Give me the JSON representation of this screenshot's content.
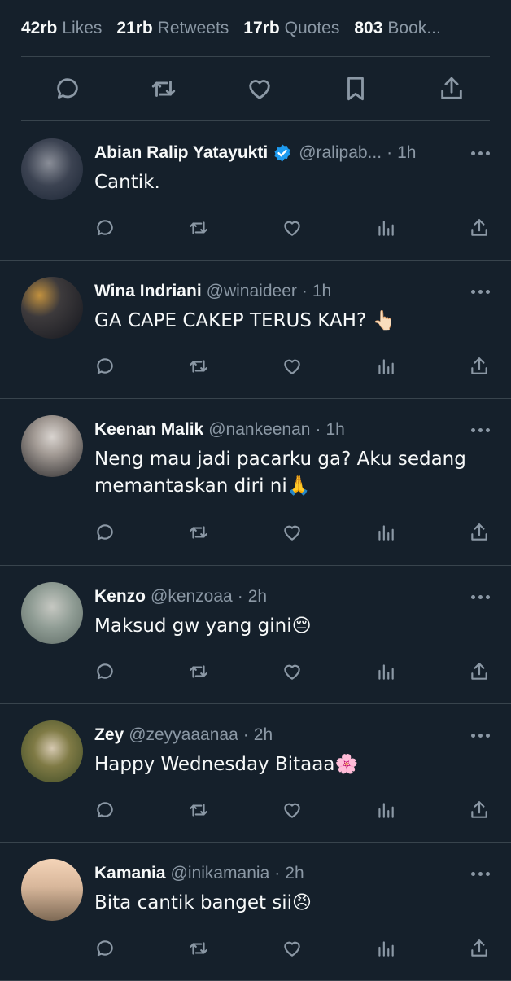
{
  "stats": [
    {
      "value": "42rb",
      "label": "Likes"
    },
    {
      "value": "21rb",
      "label": "Retweets"
    },
    {
      "value": "17rb",
      "label": "Quotes"
    },
    {
      "value": "803",
      "label": "Book..."
    }
  ],
  "tweet_actions": [
    "reply-icon",
    "retweet-icon",
    "like-icon",
    "bookmark-icon",
    "share-icon"
  ],
  "colors": {
    "background": "#15202b",
    "muted": "#8b98a5",
    "divider": "#38444d",
    "verified": "#1d9bf0"
  },
  "replies": [
    {
      "name": "Abian Ralip Yatayukti",
      "verified": true,
      "handle": "@ralipab...",
      "time": "1h",
      "text": "Cantik."
    },
    {
      "name": "Wina Indriani",
      "verified": false,
      "handle": "@winaideer",
      "time": "1h",
      "text": "GA CAPE CAKEP TERUS KAH? 👆🏻"
    },
    {
      "name": "Keenan Malik",
      "verified": false,
      "handle": "@nankeenan",
      "time": "1h",
      "text": "Neng mau jadi pacarku ga? Aku sedang memantaskan diri ni🙏"
    },
    {
      "name": "Kenzo",
      "verified": false,
      "handle": "@kenzoaa",
      "time": "2h",
      "text": "Maksud gw yang gini😔"
    },
    {
      "name": "Zey",
      "verified": false,
      "handle": "@zeyyaaanaa",
      "time": "2h",
      "text": "Happy Wednesday Bitaaa🌸"
    },
    {
      "name": "Kamania",
      "verified": false,
      "handle": "@inikamania",
      "time": "2h",
      "text": "Bita cantik banget sii😠"
    }
  ]
}
